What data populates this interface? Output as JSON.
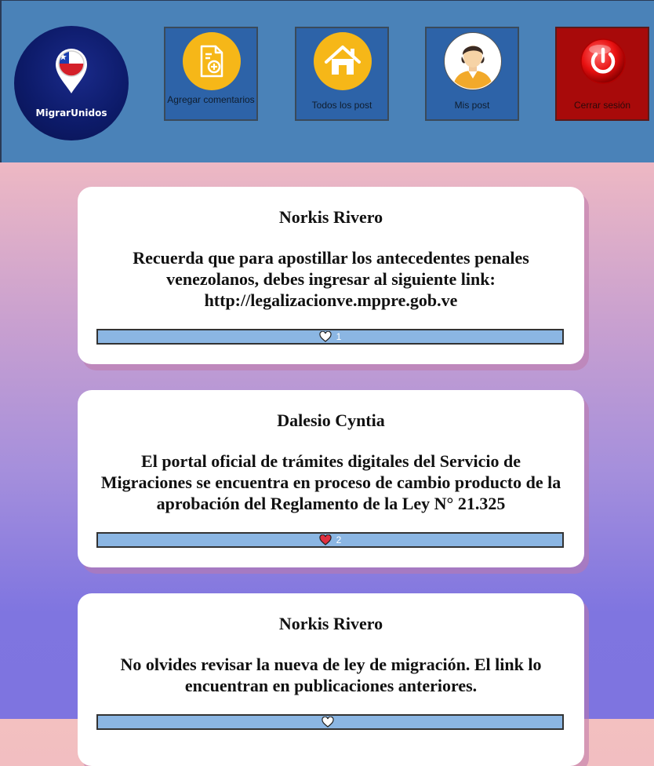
{
  "brand": {
    "name": "MigrarUnidos"
  },
  "nav": {
    "add_comment_label": "Agregar comentarios",
    "all_posts_label": "Todos los post",
    "my_posts_label": "Mis post",
    "logout_label": "Cerrar sesión"
  },
  "icons": {
    "add_comment": "document-plus-icon",
    "all_posts": "home-icon",
    "my_posts": "user-avatar-icon",
    "logout": "power-icon",
    "like_empty": "heart-outline-icon",
    "like_filled": "heart-filled-icon"
  },
  "colors": {
    "header_bg": "#4a82b8",
    "nav_button_bg": "#2d63a8",
    "logout_bg": "#a80a0a",
    "icon_circle": "#f6b718",
    "like_bar_bg": "#8bb6e3",
    "liked_heart": "#e03040"
  },
  "posts": [
    {
      "author": "Norkis Rivero",
      "text": "Recuerda que para apostillar los antecedentes penales venezolanos, debes ingresar al siguiente link: http://legalizacionve.mppre.gob.ve",
      "likes": "1",
      "liked": false
    },
    {
      "author": "Dalesio Cyntia",
      "text": "El portal oficial de trámites digitales del Servicio de Migraciones se encuentra en proceso de cambio producto de la aprobación del Reglamento de la Ley N° 21.325",
      "likes": "2",
      "liked": true
    },
    {
      "author": "Norkis Rivero",
      "text": "No olvides revisar la nueva de ley de migración. El link lo encuentran en publicaciones anteriores.",
      "likes": "",
      "liked": false
    }
  ]
}
